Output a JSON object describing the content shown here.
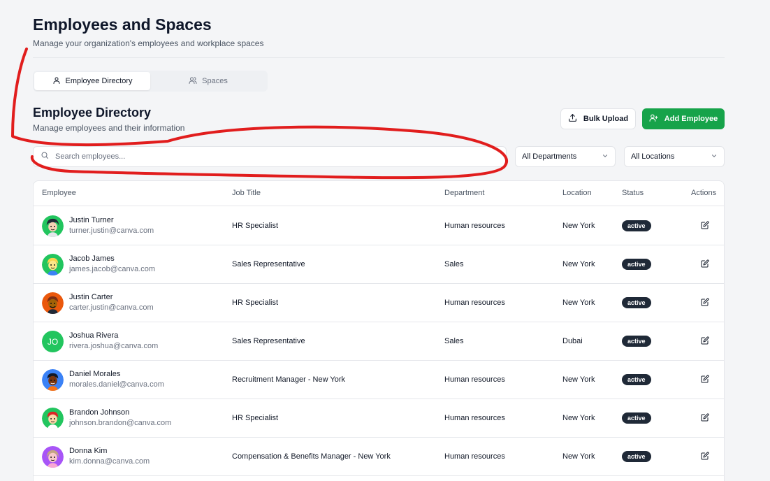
{
  "header": {
    "title": "Employees and Spaces",
    "subtitle": "Manage your organization's employees and workplace spaces"
  },
  "tabs": [
    {
      "label": "Employee Directory",
      "icon": "user-icon",
      "active": true
    },
    {
      "label": "Spaces",
      "icon": "users-icon",
      "active": false
    }
  ],
  "section": {
    "title": "Employee Directory",
    "subtitle": "Manage employees and their information"
  },
  "actions": {
    "bulk_upload_label": "Bulk Upload",
    "add_employee_label": "Add Employee"
  },
  "filters": {
    "search_placeholder": "Search employees...",
    "department_selected": "All Departments",
    "location_selected": "All Locations"
  },
  "table": {
    "columns": [
      "Employee",
      "Job Title",
      "Department",
      "Location",
      "Status",
      "Actions"
    ],
    "rows": [
      {
        "name": "Justin Turner",
        "email": "turner.justin@canva.com",
        "job_title": "HR Specialist",
        "department": "Human resources",
        "location": "New York",
        "status": "active",
        "avatar": "illustrated-avatar"
      },
      {
        "name": "Jacob James",
        "email": "james.jacob@canva.com",
        "job_title": "Sales Representative",
        "department": "Sales",
        "location": "New York",
        "status": "active",
        "avatar": "illustrated-avatar"
      },
      {
        "name": "Justin Carter",
        "email": "carter.justin@canva.com",
        "job_title": "HR Specialist",
        "department": "Human resources",
        "location": "New York",
        "status": "active",
        "avatar": "illustrated-avatar"
      },
      {
        "name": "Joshua Rivera",
        "email": "rivera.joshua@canva.com",
        "job_title": "Sales Representative",
        "department": "Sales",
        "location": "Dubai",
        "status": "active",
        "avatar": "initials",
        "initials": "JO"
      },
      {
        "name": "Daniel Morales",
        "email": "morales.daniel@canva.com",
        "job_title": "Recruitment Manager - New York",
        "department": "Human resources",
        "location": "New York",
        "status": "active",
        "avatar": "illustrated-avatar"
      },
      {
        "name": "Brandon Johnson",
        "email": "johnson.brandon@canva.com",
        "job_title": "HR Specialist",
        "department": "Human resources",
        "location": "New York",
        "status": "active",
        "avatar": "illustrated-avatar"
      },
      {
        "name": "Donna Kim",
        "email": "kim.donna@canva.com",
        "job_title": "Compensation & Benefits Manager - New York",
        "department": "Human resources",
        "location": "New York",
        "status": "active",
        "avatar": "illustrated-avatar"
      }
    ]
  },
  "colors": {
    "primary": "#16a34a",
    "badge_bg": "#1f2937",
    "annotation": "#e11d1d"
  }
}
